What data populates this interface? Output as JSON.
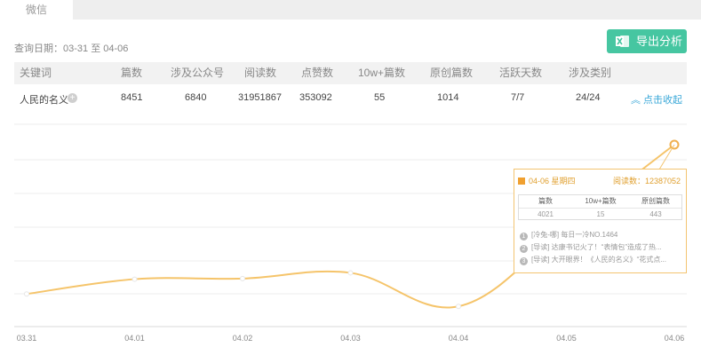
{
  "tab": {
    "label": "微信"
  },
  "query": {
    "date_range": "查询日期：03-31 至 04-06"
  },
  "export_button": {
    "label": "导出分析",
    "icon": "excel-icon",
    "color": "#46c6a1"
  },
  "table": {
    "headers": [
      "关键词",
      "篇数",
      "涉及公众号",
      "阅读数",
      "点赞数",
      "10w+篇数",
      "原创篇数",
      "活跃天数",
      "涉及类别"
    ],
    "row": {
      "keyword": "人民的名义",
      "articles": "8451",
      "accounts": "6840",
      "reads": "31951867",
      "likes": "353092",
      "w10_articles": "55",
      "original_articles": "1014",
      "active_days": "7/7",
      "categories": "24/24",
      "collapse_label": "点击收起"
    }
  },
  "tooltip": {
    "date": "04-06 星期四",
    "reads": "阅读数：12387052",
    "headers": [
      "篇数",
      "10w+篇数",
      "原创篇数"
    ],
    "values": [
      "4021",
      "15",
      "443"
    ],
    "articles": [
      {
        "num": "1",
        "text": "[冷兔-哪] 每日一冷NO.1464"
      },
      {
        "num": "2",
        "text": "[导读] 达康书记火了！“表情包”造成了热..."
      },
      {
        "num": "3",
        "text": "[导读] 大开眼界！《人民的名义》“花式点..."
      }
    ]
  },
  "chart_data": {
    "type": "line",
    "x": [
      "03.31",
      "04.01",
      "04.02",
      "04.03",
      "04.04",
      "04.05",
      "04.06"
    ],
    "x_ticks": [
      "03.31",
      "04.01",
      "04.02",
      "04.03",
      "04.04",
      "04.05",
      "04.06"
    ],
    "series": [
      {
        "values": [
          580000,
          1750000,
          1800000,
          2250000,
          -400000,
          5850000,
          12387052
        ]
      }
    ],
    "ylim": [
      -2000000,
      14000000
    ],
    "grid": true,
    "line_color": "#f5c46a"
  }
}
